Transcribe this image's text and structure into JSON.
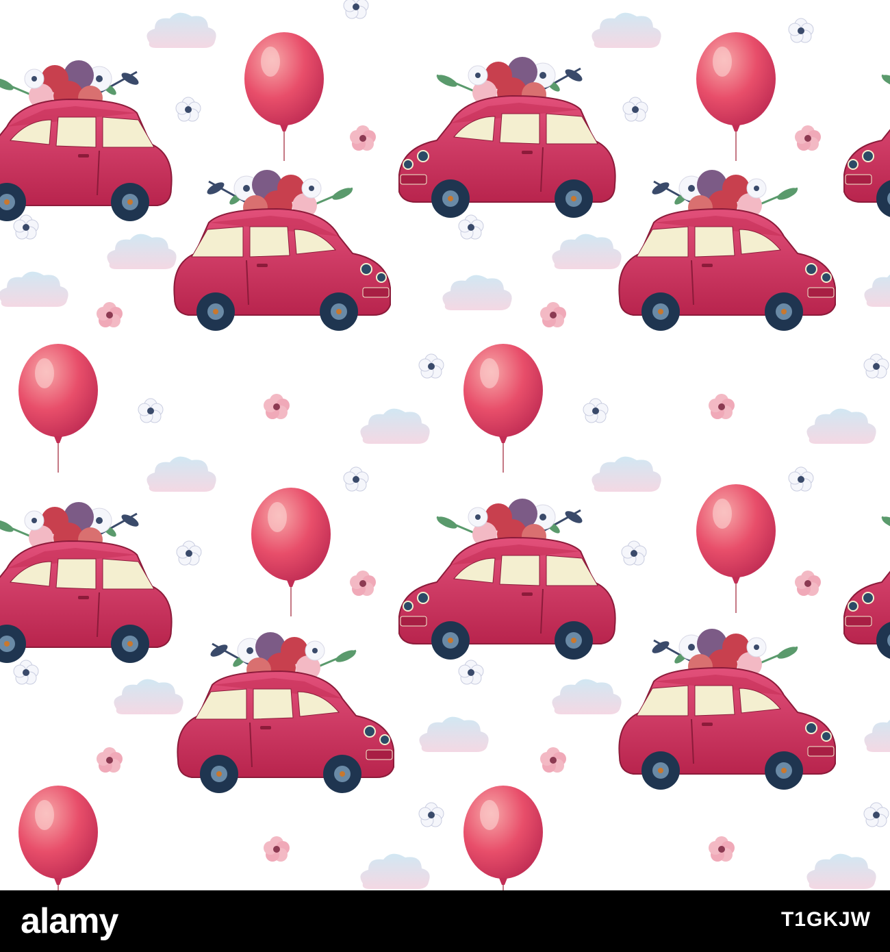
{
  "artwork": {
    "colors": {
      "car_body": "#d6355f",
      "car_dark": "#a81f44",
      "window": "#f4efd0",
      "tire": "#1f3550",
      "balloon": "#e84e6a",
      "balloon_light": "#f7a7a8",
      "cloud": "#cfe6f2",
      "cloud_pink": "#f3d6e2",
      "flower_white": "#f5f6fb",
      "flower_pink": "#f3b9c4",
      "flower_dark": "#3a4a6a",
      "rose": "#c8404e",
      "leaf": "#5a9a6c",
      "background": "#ffffff"
    }
  },
  "footer": {
    "logo": "alamy",
    "stock_id": "T1GKJW",
    "background": "#000000"
  }
}
